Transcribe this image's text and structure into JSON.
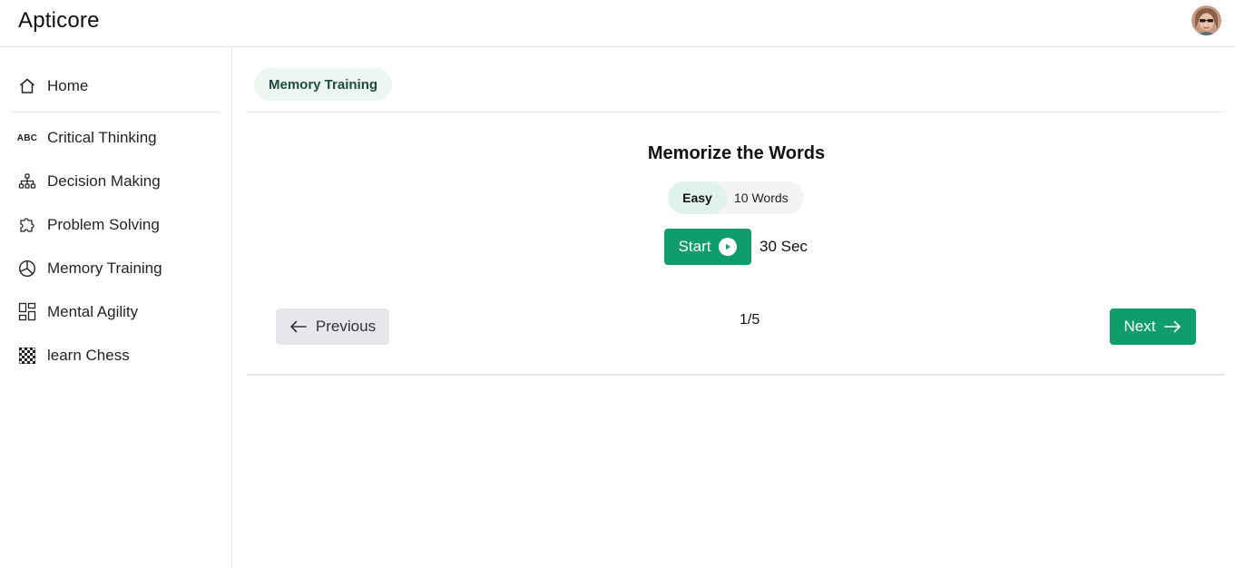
{
  "app": {
    "title": "Apticore"
  },
  "header": {
    "avatar_icon": "user-avatar"
  },
  "sidebar": {
    "items": [
      {
        "label": "Home",
        "icon": "home-icon"
      },
      {
        "label": "Critical Thinking",
        "icon": "abc-icon",
        "icon_text": "ABC"
      },
      {
        "label": "Decision Making",
        "icon": "hierarchy-icon"
      },
      {
        "label": "Problem Solving",
        "icon": "puzzle-icon"
      },
      {
        "label": "Memory Training",
        "icon": "pie-chart-icon"
      },
      {
        "label": "Mental Agility",
        "icon": "grid-layout-icon"
      },
      {
        "label": "learn Chess",
        "icon": "chessboard-icon"
      }
    ]
  },
  "main": {
    "active_chip": "Memory Training",
    "exercise": {
      "title": "Memorize the Words",
      "difficulty": "Easy",
      "word_count": "10 Words",
      "start_label": "Start",
      "timer": "30 Sec"
    },
    "pagination": {
      "previous_label": "Previous",
      "indicator": "1/5",
      "next_label": "Next"
    }
  },
  "colors": {
    "accent": "#0f9d6b",
    "chip_bg": "#ecf7f2",
    "chip_text": "#1d4d3a",
    "easy_bg": "#dff3ea",
    "secondary_button_bg": "#e5e7eb",
    "border": "#e5e7eb"
  }
}
